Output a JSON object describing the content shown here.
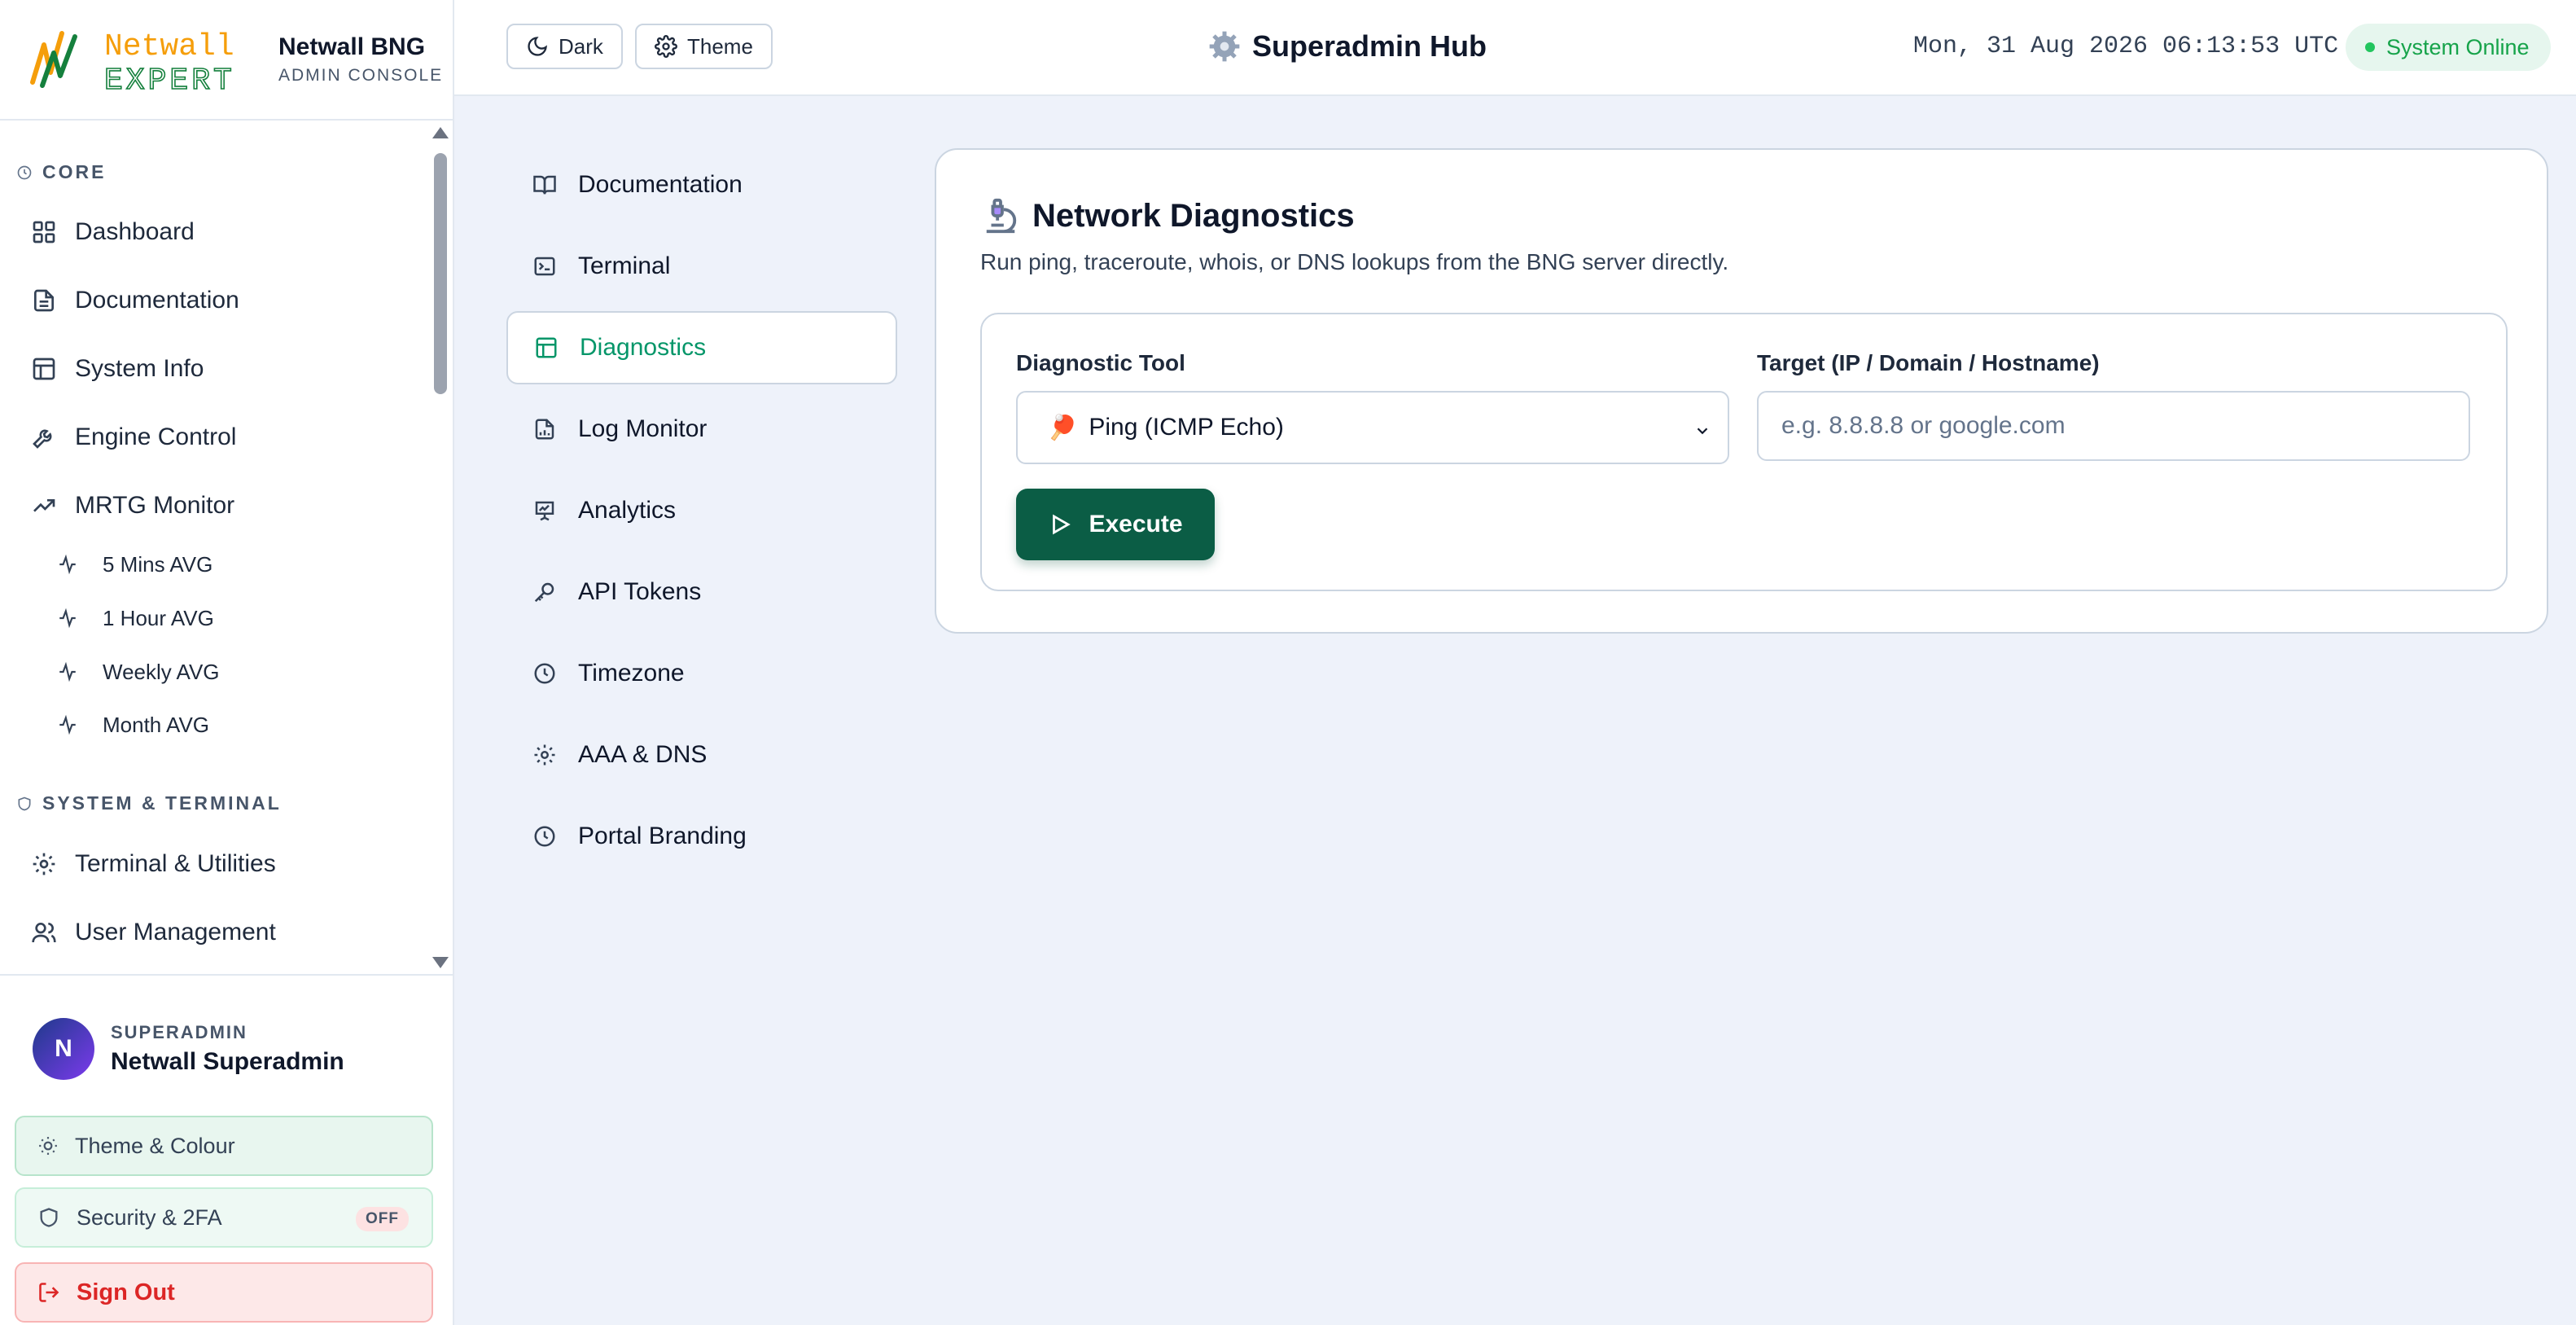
{
  "brand": {
    "logo_line1": "Netwall",
    "logo_line2": "EXPERT",
    "name": "Netwall BNG",
    "subtitle": "ADMIN CONSOLE"
  },
  "sidebar": {
    "sections": [
      {
        "title": "CORE",
        "items": [
          {
            "label": "Dashboard",
            "icon": "grid-icon"
          },
          {
            "label": "Documentation",
            "icon": "file-icon"
          },
          {
            "label": "System Info",
            "icon": "layout-icon"
          },
          {
            "label": "Engine Control",
            "icon": "wrench-icon"
          },
          {
            "label": "MRTG Monitor",
            "icon": "trending-up-icon"
          }
        ],
        "subitems": [
          {
            "label": "5 Mins AVG",
            "icon": "activity-icon"
          },
          {
            "label": "1 Hour AVG",
            "icon": "activity-icon"
          },
          {
            "label": "Weekly AVG",
            "icon": "activity-icon"
          },
          {
            "label": "Month AVG",
            "icon": "activity-icon"
          }
        ]
      },
      {
        "title": "SYSTEM & TERMINAL",
        "items": [
          {
            "label": "Terminal & Utilities",
            "icon": "gear-icon"
          },
          {
            "label": "User Management",
            "icon": "users-icon"
          }
        ]
      }
    ]
  },
  "user": {
    "initial": "N",
    "role": "SUPERADMIN",
    "name": "Netwall Superadmin"
  },
  "footer_buttons": {
    "theme": "Theme & Colour",
    "security": "Security & 2FA",
    "security_badge": "OFF",
    "signout": "Sign Out"
  },
  "topbar": {
    "dark_label": "Dark",
    "theme_label": "Theme",
    "title": "Superadmin Hub",
    "datetime": "Mon, 31 Aug 2026 06:13:53 UTC",
    "status": "System Online"
  },
  "settings_nav": {
    "active_index": 2,
    "items": [
      {
        "label": "Documentation",
        "icon": "book-icon"
      },
      {
        "label": "Terminal",
        "icon": "terminal-icon"
      },
      {
        "label": "Diagnostics",
        "icon": "table-icon"
      },
      {
        "label": "Log Monitor",
        "icon": "file-chart-icon"
      },
      {
        "label": "Analytics",
        "icon": "presentation-icon"
      },
      {
        "label": "API Tokens",
        "icon": "key-icon"
      },
      {
        "label": "Timezone",
        "icon": "clock-icon"
      },
      {
        "label": "AAA & DNS",
        "icon": "gear-icon"
      },
      {
        "label": "Portal Branding",
        "icon": "clock-icon"
      }
    ]
  },
  "diagnostics": {
    "title": "Network Diagnostics",
    "description": "Run ping, traceroute, whois, or DNS lookups from the BNG server directly.",
    "tool_label": "Diagnostic Tool",
    "tool_selected": "Ping (ICMP Echo)",
    "tool_emoji": "🏓",
    "target_label": "Target (IP / Domain / Hostname)",
    "target_value": "",
    "target_placeholder": "e.g. 8.8.8.8 or google.com",
    "execute_label": "Execute"
  },
  "colors": {
    "accent": "#059669",
    "execute_bg": "#0b5d45",
    "status_green": "#16a34a",
    "signout_red": "#dc2626"
  }
}
